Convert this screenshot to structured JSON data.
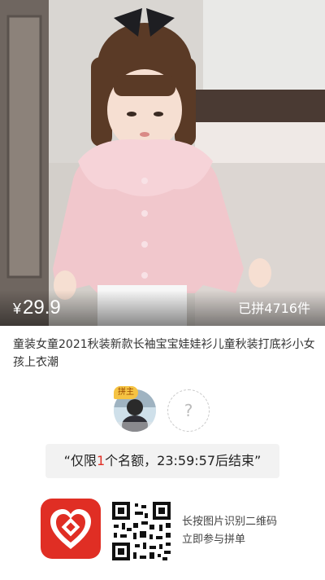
{
  "product": {
    "price_symbol": "¥",
    "price": "29.9",
    "sold": "已拼4716件",
    "title": "童装女童2021秋装新款长袖宝宝娃娃衫儿童秋装打底衫小女孩上衣潮"
  },
  "group": {
    "leader_tag": "拼主",
    "empty_slot_symbol": "?",
    "notice_prefix": "“仅限",
    "notice_count": "1",
    "notice_suffix": "个名额，23:59:57后结束”"
  },
  "footer": {
    "hint_line1": "长按图片识别二维码",
    "hint_line2": "立即参与拼单"
  },
  "colors": {
    "brand_red": "#e02e24",
    "leader_tag": "#f5c343"
  },
  "icons": {
    "app_logo": "pinduoduo-heart-icon",
    "qr": "qr-code-icon"
  }
}
